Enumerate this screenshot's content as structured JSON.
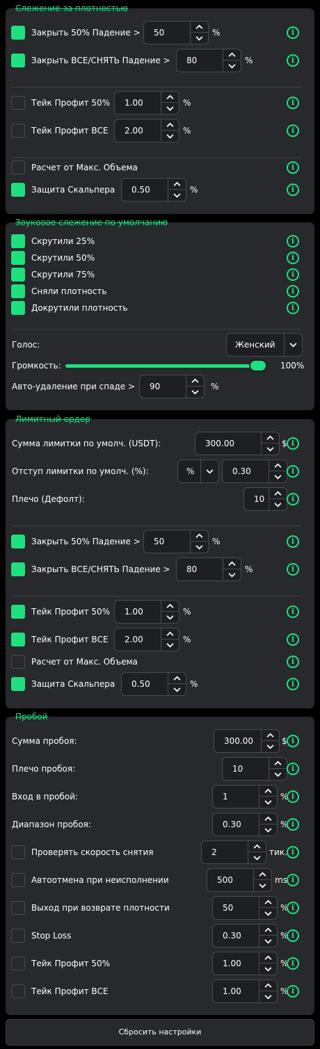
{
  "colors": {
    "accent": "#1fe07e",
    "card": "#28292d",
    "background": "#000000"
  },
  "icons": {
    "info": "info-circle-icon",
    "up": "chevron-up-icon",
    "down": "chevron-down-icon"
  },
  "density": {
    "title": "Слежение за плотностью",
    "close50": {
      "label": "Закрыть 50% Падение >",
      "value": "50",
      "unit": "%",
      "checked": true
    },
    "closeAll": {
      "label": "Закрыть ВСЕ/СНЯТЬ Падение >",
      "value": "80",
      "unit": "%",
      "checked": true
    },
    "tp50": {
      "label": "Тейк Профит 50%",
      "value": "1.00",
      "unit": "%",
      "checked": false
    },
    "tpAll": {
      "label": "Тейк Профит ВСЕ",
      "value": "2.00",
      "unit": "%",
      "checked": false
    },
    "maxVolume": {
      "label": "Расчет от Макс. Объема",
      "checked": false
    },
    "scalper": {
      "label": "Защита Скальпера",
      "value": "0.50",
      "unit": "%",
      "checked": true
    }
  },
  "sound": {
    "title": "Звуковое слежение по умолчанию",
    "items": [
      {
        "label": "Скрутили 25%",
        "checked": true
      },
      {
        "label": "Скрутили 50%",
        "checked": true
      },
      {
        "label": "Скрутили 75%",
        "checked": true
      },
      {
        "label": "Сняли плотность",
        "checked": true
      },
      {
        "label": "Докрутили плотность",
        "checked": true
      }
    ],
    "voice": {
      "label": "Голос:",
      "value": "Женский"
    },
    "volume": {
      "label": "Громкость:",
      "value": "100%",
      "level": 100
    },
    "autodelete": {
      "label": "Авто-удаление при спаде >",
      "value": "90",
      "unit": "%"
    }
  },
  "limit": {
    "title": "Лимитный ордер",
    "amount": {
      "label": "Сумма лимитки по умолч. (USDT):",
      "value": "300.00",
      "unit": "$"
    },
    "offset": {
      "label": "Отступ лимитки по умолч. (%):",
      "mode": "%",
      "value": "0.30"
    },
    "leverage": {
      "label": "Плечо (Дефолт):",
      "value": "10"
    },
    "close50": {
      "label": "Закрыть 50% Падение >",
      "value": "50",
      "unit": "%",
      "checked": true
    },
    "closeAll": {
      "label": "Закрыть ВСЕ/СНЯТЬ Падение >",
      "value": "80",
      "unit": "%",
      "checked": true
    },
    "tp50": {
      "label": "Тейк Профит 50%",
      "value": "1.00",
      "unit": "%",
      "checked": true
    },
    "tpAll": {
      "label": "Тейк Профит ВСЕ",
      "value": "2.00",
      "unit": "%",
      "checked": true
    },
    "maxVolume": {
      "label": "Расчет от Макс. Объема",
      "checked": false
    },
    "scalper": {
      "label": "Защита Скальпера",
      "value": "0.50",
      "unit": "%",
      "checked": true
    }
  },
  "breakout": {
    "title": "Пробой",
    "amount": {
      "label": "Сумма пробоя:",
      "value": "300.00",
      "unit": "$"
    },
    "leverage": {
      "label": "Плечо пробоя:",
      "value": "10"
    },
    "entry": {
      "label": "Вход в пробой:",
      "value": "1",
      "unit": "%"
    },
    "range": {
      "label": "Диапазон пробоя:",
      "value": "0.30",
      "unit": "%"
    },
    "speed": {
      "label": "Проверять скорость снятия",
      "value": "2",
      "unit": "тик.",
      "checked": false
    },
    "autocancel": {
      "label": "Автоотмена при неисполнении",
      "value": "500",
      "unit": "ms",
      "checked": false
    },
    "exitReturn": {
      "label": "Выход при возврате плотности",
      "value": "50",
      "unit": "%",
      "checked": false
    },
    "stopLoss": {
      "label": "Stop Loss",
      "value": "0.30",
      "unit": "%",
      "checked": false
    },
    "tp50": {
      "label": "Тейк Профит 50%",
      "value": "1.00",
      "unit": "%",
      "checked": false
    },
    "tpAll": {
      "label": "Тейк Профит ВСЕ",
      "value": "1.00",
      "unit": "%",
      "checked": false
    }
  },
  "reset": {
    "label": "Сбросить настройки"
  }
}
